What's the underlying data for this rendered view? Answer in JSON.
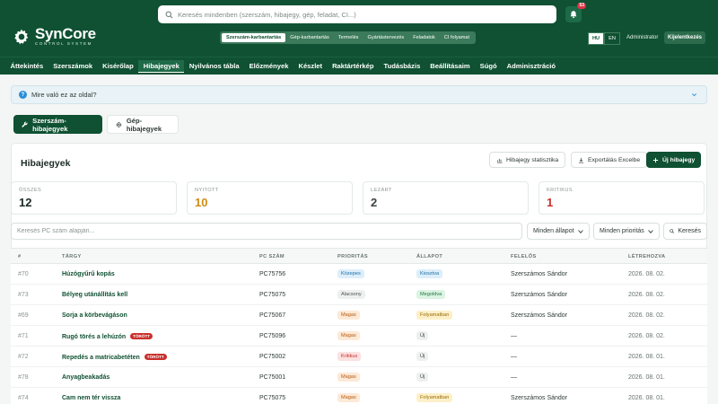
{
  "app": {
    "logo_title": "SynCore",
    "logo_subtitle": "CONTROL SYSTEM",
    "search_placeholder": "Keresés mindenben (szerszám, hibajegy, gép, feladat, CI...)",
    "notification_count": "53",
    "modules": [
      {
        "label": "Szerszám-karbantartás",
        "active": true
      },
      {
        "label": "Gép-karbantartás",
        "active": false
      },
      {
        "label": "Termelés",
        "active": false
      },
      {
        "label": "Gyártástervezés",
        "active": false
      },
      {
        "label": "Feladatok",
        "active": false
      },
      {
        "label": "CI folyamat",
        "active": false
      }
    ],
    "languages": [
      {
        "label": "HU",
        "active": true
      },
      {
        "label": "EN",
        "active": false
      }
    ],
    "user": "Administrator",
    "logout_label": "Kijelentkezés"
  },
  "nav": [
    {
      "label": "Áttekintés",
      "active": false
    },
    {
      "label": "Szerszámok",
      "active": false
    },
    {
      "label": "Kisérőlap",
      "active": false
    },
    {
      "label": "Hibajegyek",
      "active": true
    },
    {
      "label": "Nyilvános tábla",
      "active": false
    },
    {
      "label": "Előzmények",
      "active": false
    },
    {
      "label": "Készlet",
      "active": false
    },
    {
      "label": "Raktártérkép",
      "active": false
    },
    {
      "label": "Tudásbázis",
      "active": false
    },
    {
      "label": "Beállításaim",
      "active": false
    },
    {
      "label": "Súgó",
      "active": false
    },
    {
      "label": "Adminisztráció",
      "active": false
    }
  ],
  "help": {
    "label": "Mire való ez az oldal?"
  },
  "tabs": [
    {
      "label": "Szerszám-hibajegyek",
      "active": true
    },
    {
      "label": "Gép-hibajegyek",
      "active": false
    }
  ],
  "page": {
    "title": "Hibajegyek",
    "actions": {
      "stats": "Hibajegy statisztika",
      "export": "Exportálás Excelbe",
      "new": "Új hibajegy"
    }
  },
  "stats": [
    {
      "label": "ÖSSZES",
      "value": "12",
      "color": "#1b2a24"
    },
    {
      "label": "NYITOTT",
      "value": "10",
      "color": "#d08c16"
    },
    {
      "label": "LEZÁRT",
      "value": "2",
      "color": "#3a4540"
    },
    {
      "label": "KRITIKUS",
      "value": "1",
      "color": "#c9302c"
    }
  ],
  "filters": {
    "search_placeholder": "Keresés PC szám alapján...",
    "status": "Minden állapot",
    "priority": "Minden prioritás",
    "search_button": "Keresés"
  },
  "table": {
    "headers": {
      "id": "#",
      "subject": "TÁRGY",
      "pc": "PC SZÁM",
      "priority": "PRIORITÁS",
      "status": "ÁLLAPOT",
      "responsible": "FELELŐS",
      "created": "LÉTREHOZVA"
    },
    "rows": [
      {
        "id": "#70",
        "subject": "Húzógyűrű kopás",
        "broken": "",
        "pc": "PC75756",
        "priority": "Közepes",
        "status": "Kiosztva",
        "responsible": "Szerszámos Sándor",
        "created": "2026. 08. 02."
      },
      {
        "id": "#73",
        "subject": "Bélyeg utánállítás kell",
        "broken": "",
        "pc": "PC75075",
        "priority": "Alacsony",
        "status": "Megoldva",
        "responsible": "Szerszámos Sándor",
        "created": "2026. 08. 02."
      },
      {
        "id": "#69",
        "subject": "Sorja a körbevágáson",
        "broken": "",
        "pc": "PC75067",
        "priority": "Magas",
        "status": "Folyamatban",
        "responsible": "Szerszámos Sándor",
        "created": "2026. 08. 02."
      },
      {
        "id": "#71",
        "subject": "Rugó törés a lehúzón",
        "broken": "TÖRÖTT",
        "pc": "PC75096",
        "priority": "Magas",
        "status": "Új",
        "responsible": "—",
        "created": "2026. 08. 02."
      },
      {
        "id": "#72",
        "subject": "Repedés a matricabetéten",
        "broken": "TÖRÖTT",
        "pc": "PC75002",
        "priority": "Kritikus",
        "status": "Új",
        "responsible": "—",
        "created": "2026. 08. 01."
      },
      {
        "id": "#78",
        "subject": "Anyagbeakadás",
        "broken": "",
        "pc": "PC75001",
        "priority": "Magas",
        "status": "Új",
        "responsible": "—",
        "created": "2026. 08. 01."
      },
      {
        "id": "#74",
        "subject": "Cam nem tér vissza",
        "broken": "",
        "pc": "PC75075",
        "priority": "Magas",
        "status": "Folyamatban",
        "responsible": "Szerszámos Sándor",
        "created": "2026. 08. 01."
      }
    ]
  },
  "badge_styles": {
    "Közepes": {
      "bg": "#dceefa",
      "fg": "#1f6fa8"
    },
    "Alacsony": {
      "bg": "#eef0ef",
      "fg": "#4a5550"
    },
    "Magas": {
      "bg": "#fde9d6",
      "fg": "#b65a12"
    },
    "Kritikus": {
      "bg": "#fbe1e0",
      "fg": "#c9302c"
    },
    "Kiosztva": {
      "bg": "#dceefa",
      "fg": "#1f6fa8"
    },
    "Megoldva": {
      "bg": "#dcf3e3",
      "fg": "#1e7a43"
    },
    "Folyamatban": {
      "bg": "#fdf0c9",
      "fg": "#9a6b06"
    },
    "Új": {
      "bg": "#eef0ef",
      "fg": "#3a4540"
    }
  }
}
